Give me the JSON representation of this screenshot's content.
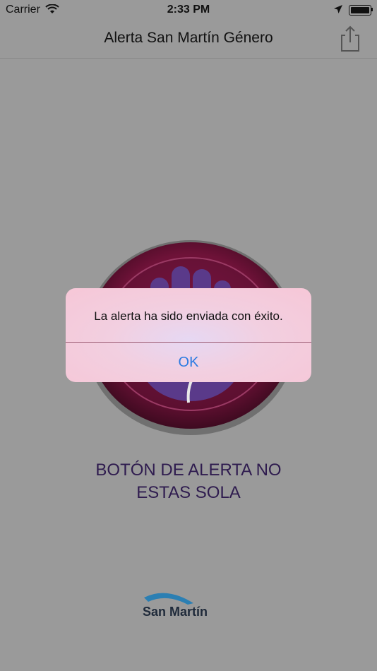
{
  "status_bar": {
    "carrier": "Carrier",
    "time": "2:33 PM",
    "icons": [
      "wifi-icon",
      "location-arrow-icon",
      "battery-icon"
    ]
  },
  "nav": {
    "title": "Alerta San Martín Género",
    "share_icon": "share-icon"
  },
  "alert_button": {
    "icon": "hand-icon",
    "caption_line1": "BOTÓN DE ALERTA NO",
    "caption_line2": "ESTAS SOLA"
  },
  "logo": {
    "text": "San Martín"
  },
  "dialog": {
    "message": "La alerta ha sido enviada con éxito.",
    "ok_label": "OK"
  },
  "colors": {
    "overlay_background": "#9a9a9a",
    "button_maroon": "#6e1238",
    "hand_purple": "#5a3a8a",
    "ok_blue": "#2a7ae2",
    "caption_purple": "#2f1c4f"
  }
}
